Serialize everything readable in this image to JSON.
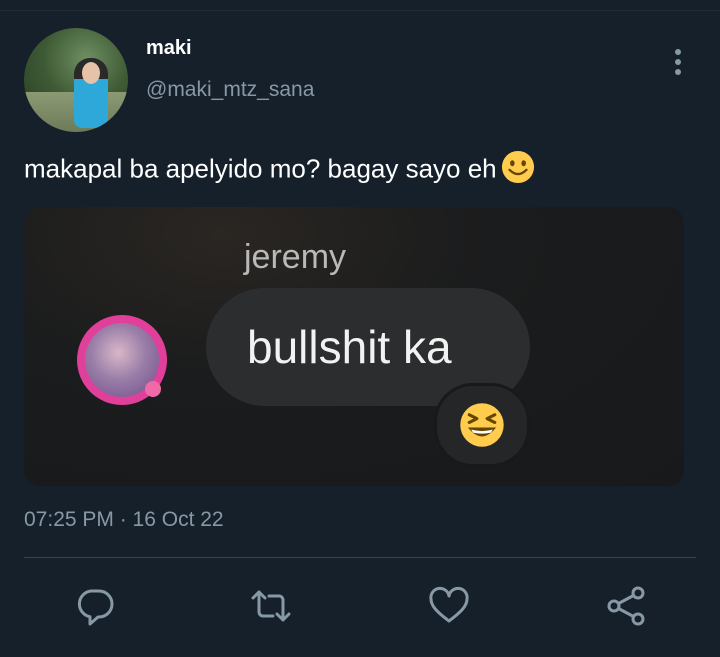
{
  "tweet": {
    "display_name": "maki",
    "handle": "@maki_mtz_sana",
    "text": "makapal ba apelyido mo? bagay sayo eh",
    "text_emoji": "slightly-smiling-face",
    "timestamp": "07:25 PM · 16 Oct 22"
  },
  "media": {
    "sender_name": "jeremy",
    "message": "bullshit ka",
    "reaction_emoji": "grinning-squinting-face"
  },
  "actions": [
    {
      "name": "reply",
      "icon": "reply-icon"
    },
    {
      "name": "retweet",
      "icon": "retweet-icon"
    },
    {
      "name": "like",
      "icon": "heart-icon"
    },
    {
      "name": "share",
      "icon": "share-icon"
    }
  ],
  "colors": {
    "background": "#15202b",
    "secondary_text": "#8899a6",
    "divider": "#38444d",
    "emoji_yellow": "#ffcc4d"
  }
}
